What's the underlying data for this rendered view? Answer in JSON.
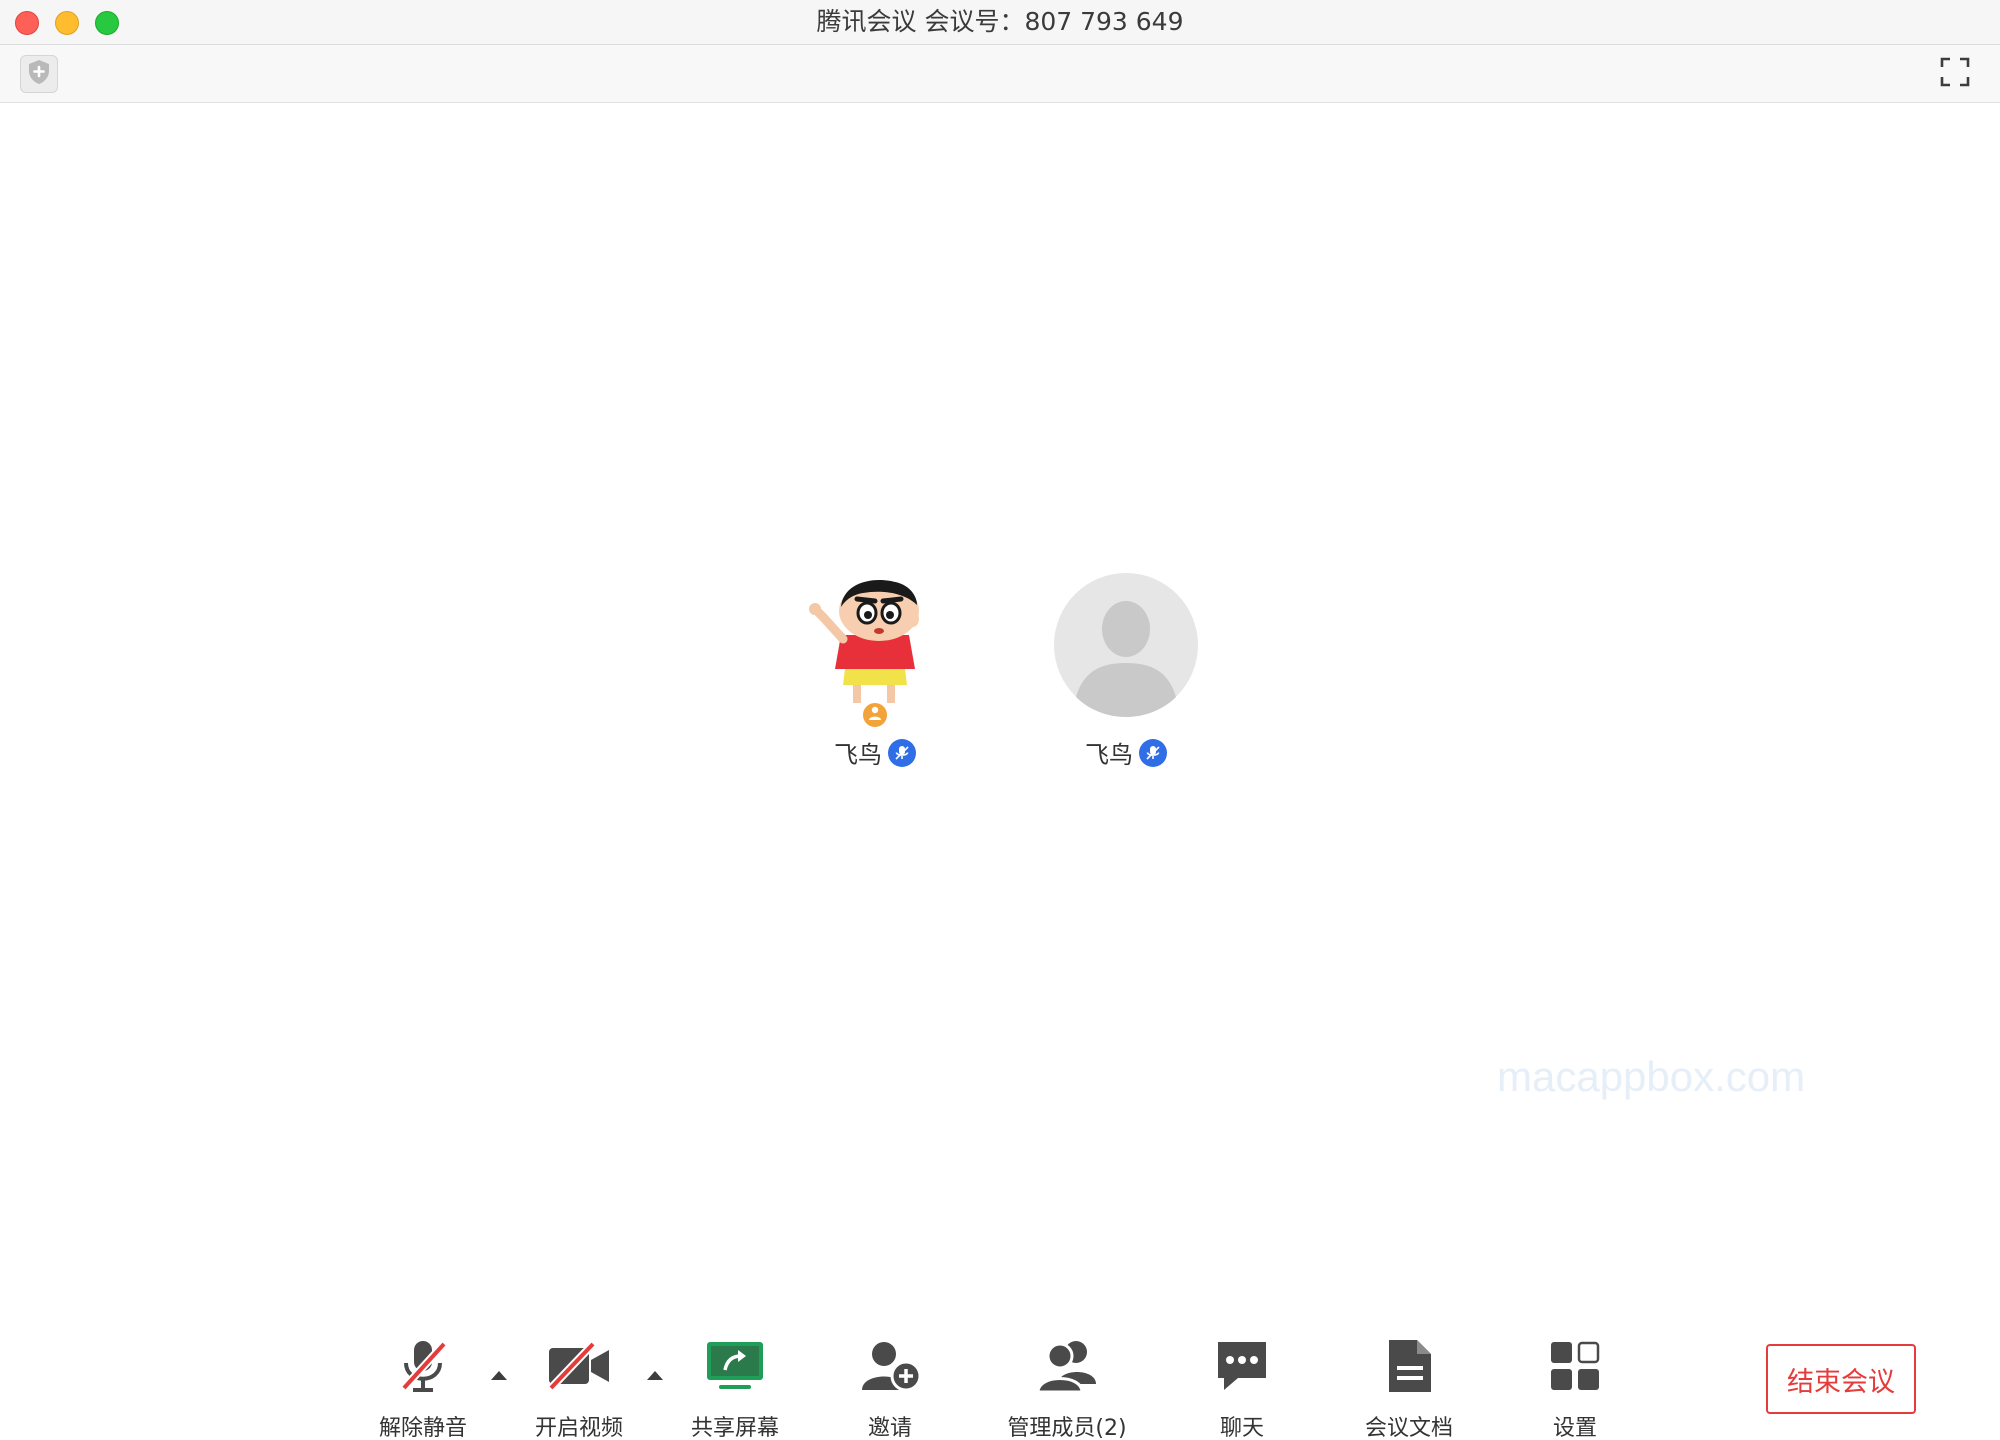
{
  "window": {
    "title": "腾讯会议 会议号：807 793 649"
  },
  "participants": [
    {
      "name": "飞鸟",
      "avatar": "cartoon-avatar",
      "is_host": true
    },
    {
      "name": "飞鸟",
      "avatar": "default-avatar",
      "is_host": false
    }
  ],
  "watermark": "macappbox.com",
  "toolbar": {
    "unmute_label": "解除静音",
    "video_label": "开启视频",
    "share_label": "共享屏幕",
    "invite_label": "邀请",
    "members_label": "管理成员(2)",
    "chat_label": "聊天",
    "docs_label": "会议文档",
    "settings_label": "设置",
    "end_label": "结束会议"
  },
  "colors": {
    "accent_red": "#e53b3b",
    "share_green": "#1f9e57",
    "mic_blue": "#2f6ee6",
    "host_orange": "#f2a33a",
    "icon_gray": "#4a4a4a"
  }
}
